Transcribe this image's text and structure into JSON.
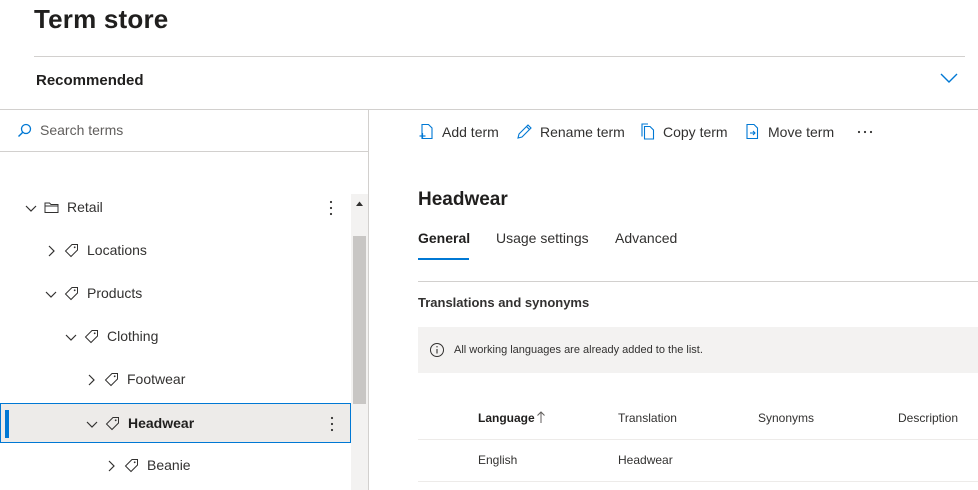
{
  "page": {
    "title": "Term store"
  },
  "recommended": {
    "label": "Recommended"
  },
  "search": {
    "placeholder": "Search terms"
  },
  "tree": [
    {
      "label": "Retail",
      "level": 0,
      "expanded": true,
      "icon": "folder-icon"
    },
    {
      "label": "Locations",
      "level": 1,
      "expanded": false,
      "icon": "tag-icon"
    },
    {
      "label": "Products",
      "level": 1,
      "expanded": true,
      "icon": "tag-icon"
    },
    {
      "label": "Clothing",
      "level": 2,
      "expanded": true,
      "icon": "tag-icon"
    },
    {
      "label": "Footwear",
      "level": 3,
      "expanded": false,
      "icon": "tag-icon"
    },
    {
      "label": "Headwear",
      "level": 3,
      "expanded": true,
      "icon": "tag-icon",
      "selected": true
    },
    {
      "label": "Beanie",
      "level": 4,
      "expanded": false,
      "icon": "tag-icon"
    }
  ],
  "commands": [
    {
      "label": "Add term",
      "icon": "add-term-icon"
    },
    {
      "label": "Rename term",
      "icon": "rename-icon"
    },
    {
      "label": "Copy term",
      "icon": "copy-icon"
    },
    {
      "label": "Move term",
      "icon": "move-icon"
    }
  ],
  "term": {
    "title": "Headwear"
  },
  "tabs": [
    {
      "label": "General",
      "active": true
    },
    {
      "label": "Usage settings",
      "active": false
    },
    {
      "label": "Advanced",
      "active": false
    }
  ],
  "translations": {
    "title": "Translations and synonyms",
    "info": "All working languages are already added to the list.",
    "columns": [
      "Language",
      "Translation",
      "Synonyms",
      "Description"
    ],
    "sort_column": "Language",
    "rows": [
      [
        "English",
        "Headwear",
        "",
        ""
      ]
    ]
  },
  "colors": {
    "accent": "#0078d4",
    "selected_bg": "#edebe9",
    "text": "#323130"
  }
}
